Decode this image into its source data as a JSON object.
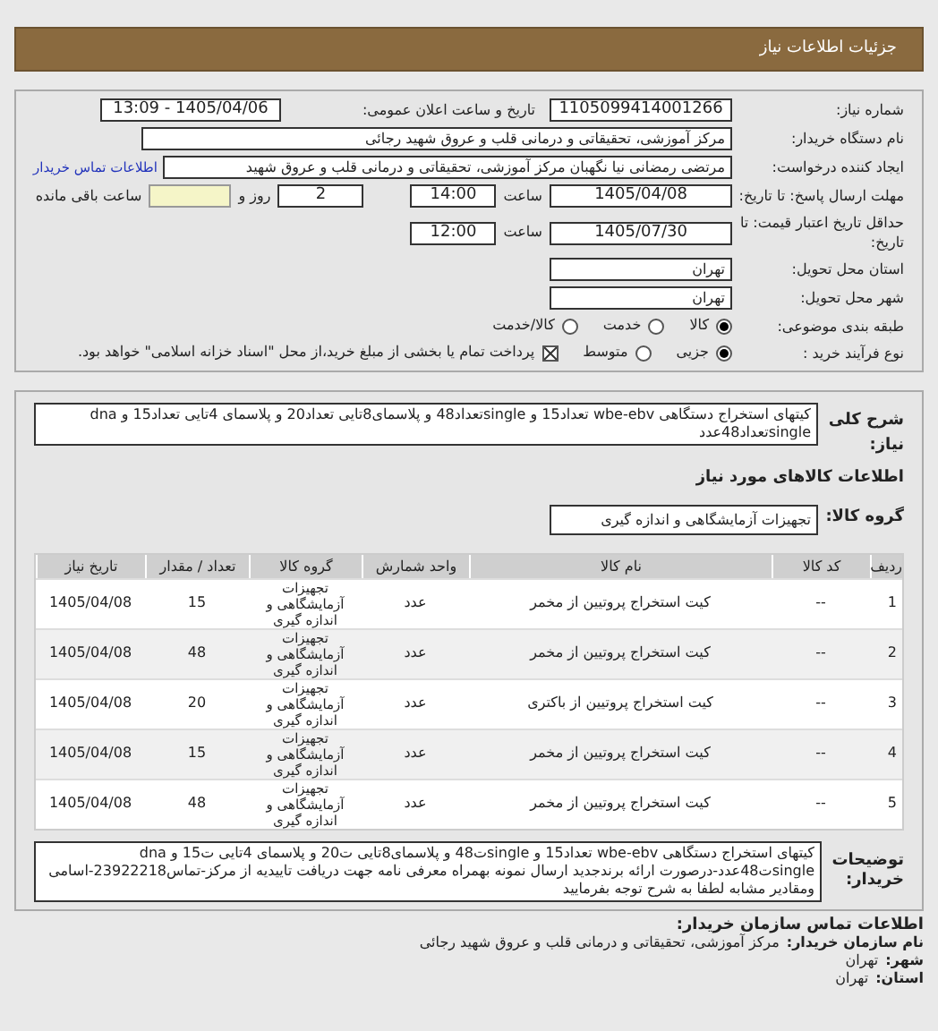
{
  "page_title": "جزئیات اطلاعات نیاز",
  "need_number": {
    "label": "شماره نیاز:",
    "value": "1105099414001266"
  },
  "announce": {
    "label": "تاریخ و ساعت اعلان عمومی:",
    "value": "1405/04/06 - 13:09"
  },
  "buyer_org": {
    "label": "نام دستگاه خریدار:",
    "value": "مرکز آموزشی، تحقیقاتی و درمانی قلب و عروق شهید رجائی"
  },
  "creator": {
    "label": "ایجاد کننده درخواست:",
    "value": "مرتضی رمضانی نیا نگهبان مرکز آموزشی، تحقیقاتی و درمانی قلب و عروق شهید",
    "link": "اطلاعات تماس خریدار"
  },
  "deadline": {
    "label": "مهلت ارسال پاسخ: تا تاریخ:",
    "date": "1405/04/08",
    "time_label": "ساعت",
    "time": "14:00",
    "days": "2",
    "days_label": "روز و",
    "remaining_label": "ساعت باقی مانده"
  },
  "validity": {
    "label": "حداقل تاریخ اعتبار قیمت: تا تاریخ:",
    "date": "1405/07/30",
    "time_label": "ساعت",
    "time": "12:00"
  },
  "province": {
    "label": "استان محل تحویل:",
    "value": "تهران"
  },
  "city": {
    "label": "شهر محل تحویل:",
    "value": "تهران"
  },
  "category": {
    "label": "طبقه بندی موضوعی:",
    "options": [
      {
        "label": "کالا",
        "selected": true
      },
      {
        "label": "خدمت",
        "selected": false
      },
      {
        "label": "کالا/خدمت",
        "selected": false
      }
    ]
  },
  "process": {
    "label": "نوع فرآیند خرید :",
    "options": [
      {
        "label": "جزیی",
        "selected": true
      },
      {
        "label": "متوسط",
        "selected": false
      }
    ],
    "payment": {
      "checked": true,
      "text": "پرداخت تمام یا بخشی از مبلغ خرید،از محل \"اسناد خزانه اسلامی\" خواهد بود."
    }
  },
  "summary": {
    "label": "شرح کلی نیاز:",
    "value": "کیتهای استخراج دستگاهی wbe-ebv تعداد15 و singleتعداد48 و پلاسمای8تایی تعداد20 و پلاسمای 4تایی تعداد15 و dna singleتعداد48عدد"
  },
  "goods_heading": "اطلاعات کالاهای مورد نیاز",
  "goods_group": {
    "label": "گروه کالا:",
    "value": "تجهیزات آزمایشگاهی و اندازه گیری"
  },
  "table": {
    "columns": [
      "ردیف",
      "کد کالا",
      "نام کالا",
      "واحد شمارش",
      "گروه کالا",
      "تعداد / مقدار",
      "تاریخ نیاز"
    ],
    "rows": [
      [
        "1",
        "--",
        "کیت استخراج پروتیین از مخمر",
        "عدد",
        "تجهیزات آزمایشگاهی و اندازه گیری",
        "15",
        "1405/04/08"
      ],
      [
        "2",
        "--",
        "کیت استخراج پروتیین از مخمر",
        "عدد",
        "تجهیزات آزمایشگاهی و اندازه گیری",
        "48",
        "1405/04/08"
      ],
      [
        "3",
        "--",
        "کیت استخراج پروتیین از باکتری",
        "عدد",
        "تجهیزات آزمایشگاهی و اندازه گیری",
        "20",
        "1405/04/08"
      ],
      [
        "4",
        "--",
        "کیت استخراج پروتیین از مخمر",
        "عدد",
        "تجهیزات آزمایشگاهی و اندازه گیری",
        "15",
        "1405/04/08"
      ],
      [
        "5",
        "--",
        "کیت استخراج پروتیین از مخمر",
        "عدد",
        "تجهیزات آزمایشگاهی و اندازه گیری",
        "48",
        "1405/04/08"
      ]
    ]
  },
  "buyer_notes": {
    "label": "توضیحات خریدار:",
    "value": "کیتهای استخراج دستگاهی wbe-ebv تعداد15 و singleت48 و پلاسمای8تایی ت20 و پلاسمای 4تایی ت15 و dna singleت48عدد-درصورت ارائه برندجدید ارسال نمونه بهمراه معرفی نامه جهت دریافت تاییدیه از مرکز-تماس23922218-اسامی ومقادیر مشابه لطفا به شرح توجه بفرمایید"
  },
  "contact": {
    "heading": "اطلاعات تماس سازمان خریدار:",
    "lines": [
      {
        "label": "نام سازمان خریدار:",
        "value": "مرکز آموزشی، تحقیقاتی و درمانی قلب و عروق شهید رجائی"
      },
      {
        "label": "شهر:",
        "value": "تهران"
      },
      {
        "label": "استان:",
        "value": "تهران"
      }
    ]
  }
}
